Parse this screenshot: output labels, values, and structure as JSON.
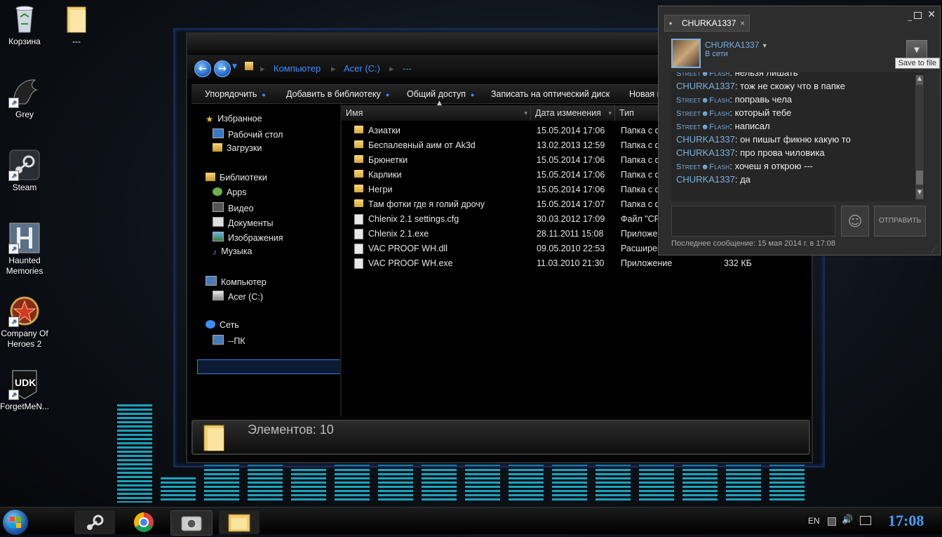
{
  "desktop_icons": [
    {
      "label": "Корзина",
      "icon": "recycle-bin-icon"
    },
    {
      "label": "---",
      "icon": "folder-icon"
    },
    {
      "label": "Grey",
      "icon": "grey-app-icon"
    },
    {
      "label": "Steam",
      "icon": "steam-icon"
    },
    {
      "label": "Haunted Memories",
      "icon": "haunted-memories-icon"
    },
    {
      "label": "Company Of Heroes 2",
      "icon": "company-of-heroes-icon"
    },
    {
      "label": "ForgetMeN...",
      "icon": "udk-icon"
    }
  ],
  "explorer": {
    "breadcrumb": [
      "Компьютер",
      "Acer (C:)",
      "---"
    ],
    "toolbar": [
      "Упорядочить",
      "Добавить в библиотеку",
      "Общий доступ",
      "Записать на оптический диск",
      "Новая папка"
    ],
    "nav": {
      "favorites": "Избранное",
      "desktop": "Рабочий стол",
      "downloads": "Загрузки",
      "libraries": "Библиотеки",
      "apps": "Apps",
      "video": "Видео",
      "docs": "Документы",
      "images": "Изображения",
      "music": "Музыка",
      "computer": "Компьютер",
      "drive": "Acer (C:)",
      "network": "Сеть",
      "pc": "--ПК"
    },
    "columns": {
      "name": "Имя",
      "date": "Дата изменения",
      "type": "Тип"
    },
    "files": [
      {
        "name": "Азиатки",
        "date": "15.05.2014 17:06",
        "type": "Папка с ф",
        "size": "",
        "kind": "folder"
      },
      {
        "name": "Беспалевный аим от Ak3d",
        "date": "13.02.2013 12:59",
        "type": "Папка с ф",
        "size": "",
        "kind": "folder"
      },
      {
        "name": "Брюнетки",
        "date": "15.05.2014 17:06",
        "type": "Папка с ф",
        "size": "",
        "kind": "folder"
      },
      {
        "name": "Карлики",
        "date": "15.05.2014 17:06",
        "type": "Папка с ф",
        "size": "",
        "kind": "folder"
      },
      {
        "name": "Негри",
        "date": "15.05.2014 17:06",
        "type": "Папка с ф",
        "size": "",
        "kind": "folder"
      },
      {
        "name": "Там фотки где я голий дрочу",
        "date": "15.05.2014 17:07",
        "type": "Папка с ф",
        "size": "",
        "kind": "folder"
      },
      {
        "name": "Chlenix 2.1 settings.cfg",
        "date": "30.03.2012 17:09",
        "type": "Файл \"CFG",
        "size": "",
        "kind": "file"
      },
      {
        "name": "Chlenix 2.1.exe",
        "date": "28.11.2011 15:08",
        "type": "Приложен",
        "size": "",
        "kind": "exe"
      },
      {
        "name": "VAC PROOF WH.dll",
        "date": "09.05.2010 22:53",
        "type": "Расширен",
        "size": "",
        "kind": "file"
      },
      {
        "name": "VAC PROOF WH.exe",
        "date": "11.03.2010 21:30",
        "type": "Приложение",
        "size": "332 КБ",
        "kind": "exe"
      }
    ],
    "status": "Элементов: 10"
  },
  "chat": {
    "tab_title": "CHURKA1337",
    "friend_name": "CHURKA1337",
    "friend_status": "В сети",
    "tooltip": "Save to file",
    "messages": [
      {
        "sender": "Street☻Flash",
        "type": "s",
        "text": "нельзя лишать"
      },
      {
        "sender": "CHURKA1337",
        "type": "c",
        "text": "тож не скожу что в папке"
      },
      {
        "sender": "Street☻Flash",
        "type": "s",
        "text": "поправь чела"
      },
      {
        "sender": "Street☻Flash",
        "type": "s",
        "text": "который тебе"
      },
      {
        "sender": "Street☻Flash",
        "type": "s",
        "text": "написал"
      },
      {
        "sender": "CHURKA1337",
        "type": "c",
        "text": "он пишыт фикню какую то"
      },
      {
        "sender": "CHURKA1337",
        "type": "c",
        "text": "про прова чиловика"
      },
      {
        "sender": "Street☻Flash",
        "type": "s",
        "text": "хочеш я открою ---"
      },
      {
        "sender": "CHURKA1337",
        "type": "c",
        "text": "да"
      }
    ],
    "send_label": "ОТПРАВИТЬ",
    "last_message": "Последнее сообщение: 15 мая 2014 г. в 17:08"
  },
  "taskbar": {
    "lang": "EN",
    "clock": "17:08"
  }
}
